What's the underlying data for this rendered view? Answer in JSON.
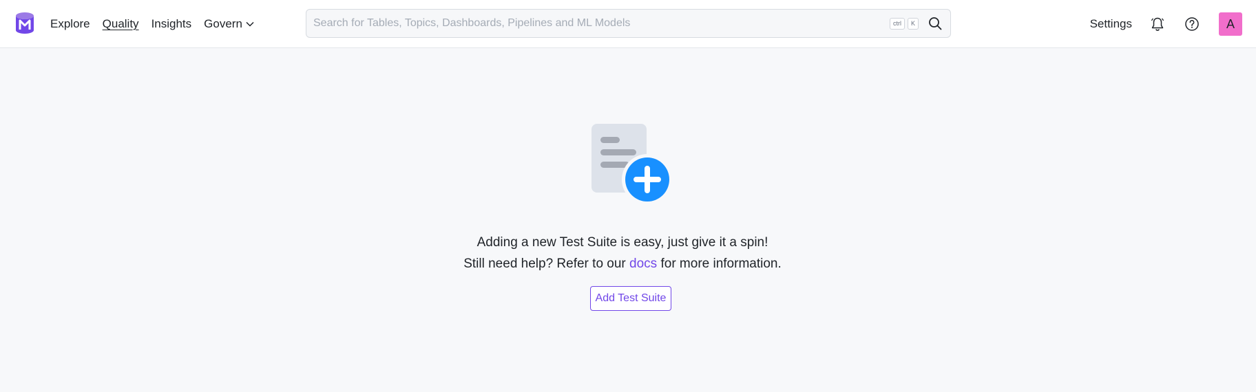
{
  "nav": {
    "items": [
      {
        "label": "Explore",
        "active": false
      },
      {
        "label": "Quality",
        "active": true
      },
      {
        "label": "Insights",
        "active": false
      },
      {
        "label": "Govern",
        "active": false,
        "has_dropdown": true
      }
    ]
  },
  "search": {
    "placeholder": "Search for Tables, Topics, Dashboards, Pipelines and ML Models",
    "value": "",
    "shortcut_keys": [
      "ctrl",
      "K"
    ]
  },
  "header_right": {
    "settings_label": "Settings",
    "avatar_initial": "A",
    "avatar_color": "#f16ecb"
  },
  "empty_state": {
    "message": "Adding a new Test Suite is easy, just give it a spin!",
    "help_prefix": "Still need help? Refer to our",
    "help_link": "docs",
    "help_suffix": "for more information.",
    "button_label": "Add Test Suite"
  },
  "colors": {
    "accent": "#7147e8",
    "add_icon": "#1890ff",
    "background": "#f7f8fa"
  }
}
